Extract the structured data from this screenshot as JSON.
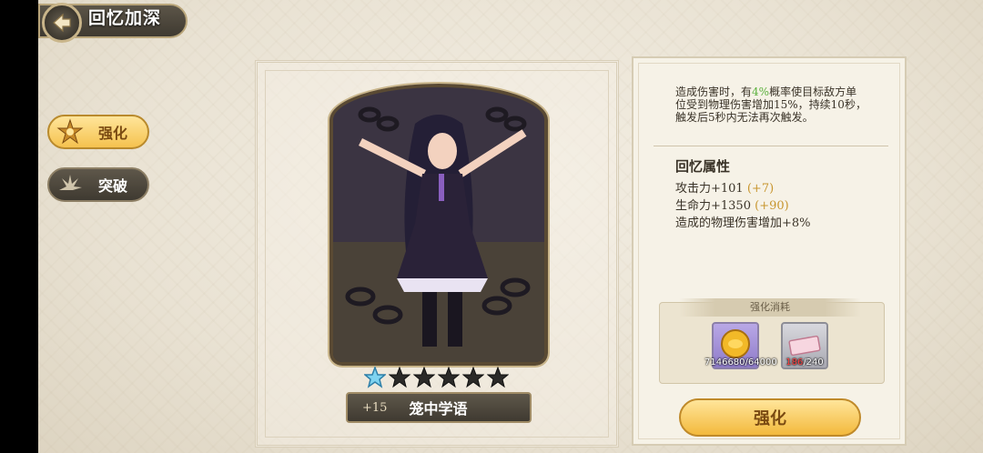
{
  "header": {
    "title": "回忆加深",
    "back_icon": "back-arrow-icon"
  },
  "tabs": [
    {
      "label": "强化",
      "active": true,
      "icon": "star-emblem-icon"
    },
    {
      "label": "突破",
      "active": false,
      "icon": "burst-icon"
    }
  ],
  "card": {
    "level": "+15",
    "name": "笼中学语",
    "stars_filled": 1,
    "stars_total": 6
  },
  "skill": {
    "desc_1": "造成伤害时，有",
    "desc_chance": "4%",
    "desc_2": "概率使目标敌方单位受到物理伤害增加15%，持续10秒，触发后5秒内无法再次触发。"
  },
  "attributes": {
    "title": "回忆属性",
    "atk": "攻击力+101",
    "atk_bonus": "(+7)",
    "hp": "生命力+1350",
    "hp_bonus": "(+90)",
    "phys": "造成的物理伤害增加+8%"
  },
  "cost": {
    "label": "强化消耗",
    "gold_have": "7146680",
    "gold_need": "/64000",
    "ticket_have": "186",
    "ticket_need": "/240"
  },
  "action": {
    "label": "强化"
  },
  "colors": {
    "accent_gold": "#f5c24f",
    "highlight_green": "#5ab03c",
    "warning_red": "#ff4040"
  }
}
